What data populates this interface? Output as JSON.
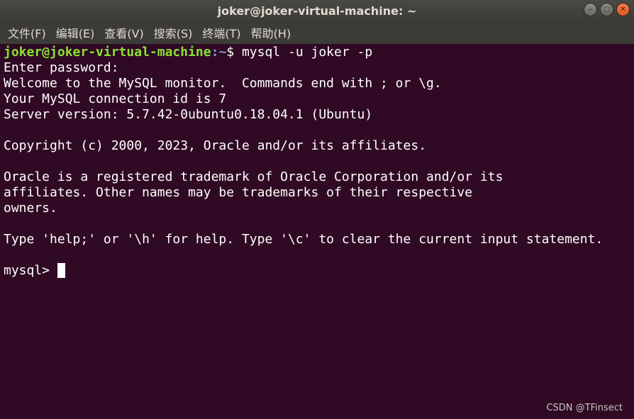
{
  "window": {
    "title": "joker@joker-virtual-machine: ~",
    "controls": [
      "minimize",
      "maximize",
      "close"
    ]
  },
  "menu": [
    "文件(F)",
    "编辑(E)",
    "查看(V)",
    "搜索(S)",
    "终端(T)",
    "帮助(H)"
  ],
  "terminal": {
    "prompt_user": "joker@joker-virtual-machine",
    "prompt_path": ":~",
    "prompt_command": "$ mysql -u joker -p",
    "lines": [
      "Enter password:",
      "Welcome to the MySQL monitor.  Commands end with ; or \\g.",
      "Your MySQL connection id is 7",
      "Server version: 5.7.42-0ubuntu0.18.04.1 (Ubuntu)",
      "",
      "Copyright (c) 2000, 2023, Oracle and/or its affiliates.",
      "",
      "Oracle is a registered trademark of Oracle Corporation and/or its",
      "affiliates. Other names may be trademarks of their respective",
      "owners.",
      "",
      "Type 'help;' or '\\h' for help. Type '\\c' to clear the current input statement.",
      ""
    ],
    "mysql_prompt": "mysql> "
  },
  "watermark": "CSDN @TFinsect",
  "colors": {
    "terminal_bg": "#300a24",
    "titlebar_bg": "#3c3b37",
    "prompt_user": "#8ae234",
    "prompt_path": "#729fcf",
    "text": "#ffffff"
  }
}
